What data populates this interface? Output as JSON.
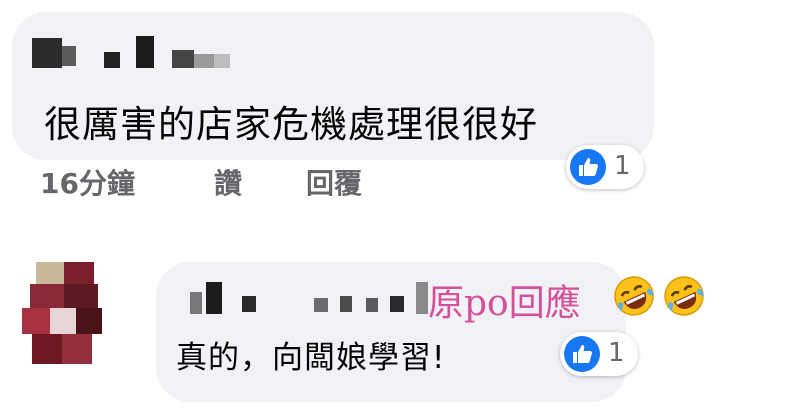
{
  "comments": [
    {
      "text": "很厲害的店家危機處理很很好",
      "timestamp": "16分鐘",
      "like_label": "讚",
      "reply_label": "回覆",
      "reaction_count": "1",
      "reaction_icon": "like-icon"
    },
    {
      "text": "真的，向闆娘學習!",
      "reaction_count": "1",
      "reaction_icon": "like-icon",
      "annotation": "原po回應",
      "annotation_emojis": [
        "rolling-on-floor-laughing-icon",
        "rolling-on-floor-laughing-icon"
      ]
    }
  ],
  "colors": {
    "bubble": "#f0f2f5",
    "like_blue": "#1877f2",
    "annotation_pink": "#d64f9c",
    "meta_gray": "#65676b"
  }
}
